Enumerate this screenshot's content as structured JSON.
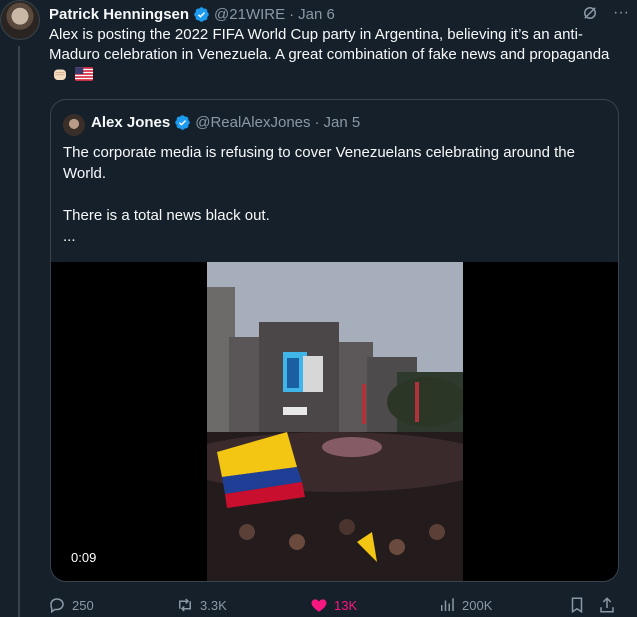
{
  "tweet": {
    "author_name": "Patrick Henningsen",
    "handle": "@21WIRE",
    "separator": "·",
    "date": "Jan 6",
    "text": "Alex is posting the 2022 FIFA World Cup party in Argentina, believing it’s an anti-Maduro celebration in Venezuela. A great combination of fake news and propaganda"
  },
  "quote": {
    "author_name": "Alex Jones",
    "handle": "@RealAlexJones",
    "separator": "·",
    "date": "Jan 5",
    "text_line1": "The corporate media is refusing to cover Venezuelans celebrating around the World.",
    "text_line2": "There is a total news black out.",
    "text_line3": "...",
    "video_duration": "0:09"
  },
  "actions": {
    "replies": "250",
    "reposts": "3.3K",
    "likes": "13K",
    "views": "200K"
  },
  "icons": [
    "verified-badge-icon",
    "grok-icon",
    "more-icon",
    "fist-emoji-icon",
    "us-flag-emoji-icon",
    "reply-icon",
    "repost-icon",
    "like-icon",
    "views-icon",
    "bookmark-icon",
    "share-icon"
  ],
  "colors": {
    "background": "#15202b",
    "verified": "#1d9bf0",
    "like": "#f91880",
    "muted": "#8b98a5"
  }
}
